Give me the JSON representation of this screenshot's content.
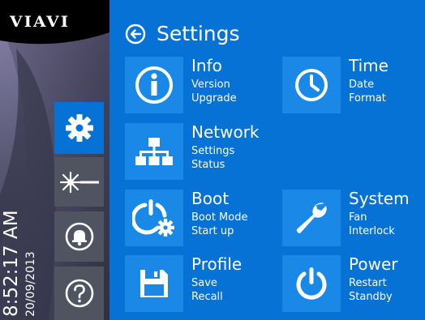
{
  "brand": {
    "logo_text": "VIAVI"
  },
  "status": {
    "time": "8:52:17 AM",
    "date": "20/09/2013"
  },
  "rail": {
    "items": [
      {
        "name": "settings",
        "icon": "gear-icon",
        "active": true
      },
      {
        "name": "laser",
        "icon": "laser-icon",
        "active": false
      },
      {
        "name": "alarm",
        "icon": "bell-icon",
        "active": false
      },
      {
        "name": "help",
        "icon": "question-icon",
        "active": false
      }
    ]
  },
  "header": {
    "title": "Settings",
    "back_icon": "back-arrow-icon"
  },
  "tiles": {
    "info": {
      "title": "Info",
      "sub1": "Version",
      "sub2": "Upgrade",
      "icon": "info-icon"
    },
    "time": {
      "title": "Time",
      "sub1": "Date",
      "sub2": "Format",
      "icon": "clock-icon"
    },
    "network": {
      "title": "Network",
      "sub1": "Settings",
      "sub2": "Status",
      "icon": "network-icon"
    },
    "boot": {
      "title": "Boot",
      "sub1": "Boot Mode",
      "sub2": "Start up",
      "icon": "boot-gear-icon"
    },
    "system": {
      "title": "System",
      "sub1": "Fan",
      "sub2": "Interlock",
      "icon": "wrench-icon"
    },
    "profile": {
      "title": "Profile",
      "sub1": "Save",
      "sub2": "Recall",
      "icon": "floppy-disk-icon"
    },
    "power": {
      "title": "Power",
      "sub1": "Restart",
      "sub2": "Standby",
      "icon": "power-icon"
    }
  },
  "colors": {
    "main_bg": "#0672d6",
    "tile_bg": "#1a88e6",
    "rail_bg": "#3a3d52",
    "rail_button": "#505461",
    "logo_band": "#000000"
  }
}
